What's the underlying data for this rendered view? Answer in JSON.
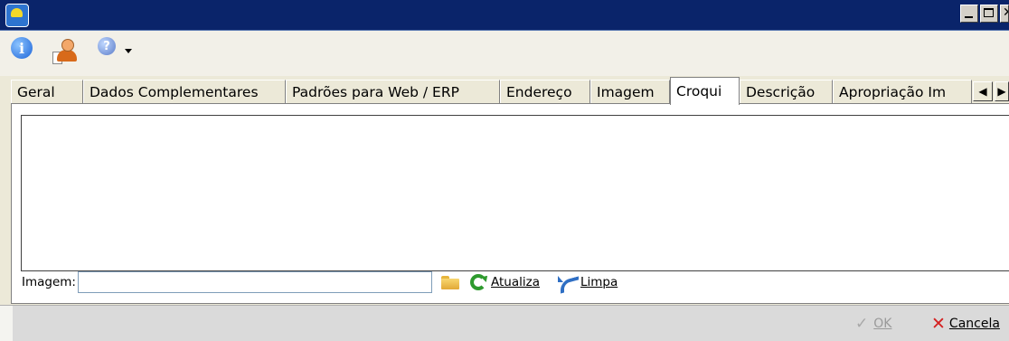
{
  "window": {
    "title": ""
  },
  "tabs": [
    {
      "label": "Geral",
      "active": false
    },
    {
      "label": "Dados Complementares",
      "active": false
    },
    {
      "label": "Padrões para Web / ERP",
      "active": false
    },
    {
      "label": "Endereço",
      "active": false
    },
    {
      "label": "Imagem",
      "active": false
    },
    {
      "label": "Croqui",
      "active": true
    },
    {
      "label": "Descrição",
      "active": false
    },
    {
      "label": "Apropriação Im",
      "active": false
    }
  ],
  "panel": {
    "image_label": "Imagem:",
    "image_value": "",
    "refresh_label": "Atualiza",
    "clear_label": "Limpa"
  },
  "footer": {
    "ok_label": "OK",
    "cancel_label": "Cancela"
  }
}
